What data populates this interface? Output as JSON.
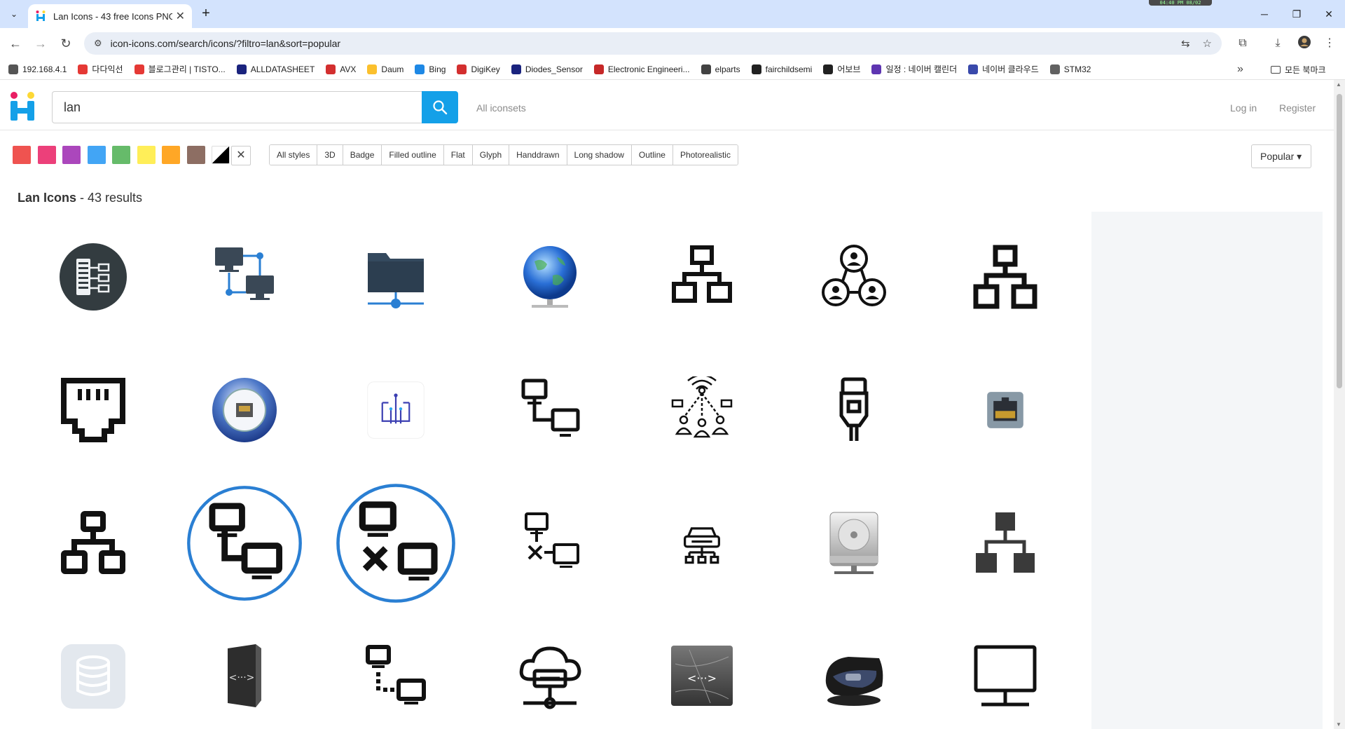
{
  "browser": {
    "tab_title": "Lan Icons - 43 free Icons PNG",
    "clock": "04:40 PM 08/02",
    "url_host": "icon-icons.com",
    "url_path": "/search/icons/?filtro=lan&sort=popular",
    "bookmarks": [
      {
        "label": "192.168.4.1",
        "color": "#555555"
      },
      {
        "label": "다다익선",
        "color": "#e53935"
      },
      {
        "label": "블로그관리 | TISTO...",
        "color": "#e53935"
      },
      {
        "label": "ALLDATASHEET",
        "color": "#1a237e"
      },
      {
        "label": "AVX",
        "color": "#d32f2f"
      },
      {
        "label": "Daum",
        "color": "#fbc02d"
      },
      {
        "label": "Bing",
        "color": "#1e88e5"
      },
      {
        "label": "DigiKey",
        "color": "#d32f2f"
      },
      {
        "label": "Diodes_Sensor",
        "color": "#1a237e"
      },
      {
        "label": "Electronic Engineeri...",
        "color": "#c62828"
      },
      {
        "label": "elparts",
        "color": "#424242"
      },
      {
        "label": "fairchildsemi",
        "color": "#212121"
      },
      {
        "label": "어보브",
        "color": "#212121"
      },
      {
        "label": "일정 : 네이버 캘린더",
        "color": "#5e35b1"
      },
      {
        "label": "네이버 클라우드",
        "color": "#3949ab"
      },
      {
        "label": "STM32",
        "color": "#616161"
      }
    ],
    "all_bookmarks": "모든 북마크"
  },
  "header": {
    "search_value": "lan",
    "all_iconsets": "All iconsets",
    "login": "Log in",
    "register": "Register"
  },
  "filters": {
    "colors": [
      "#ef5350",
      "#ec407a",
      "#ab47bc",
      "#42a5f5",
      "#66bb6a",
      "#ffee58",
      "#ffa726",
      "#8d6e63",
      "#000000"
    ],
    "styles": [
      "All styles",
      "3D",
      "Badge",
      "Filled outline",
      "Flat",
      "Glyph",
      "Handdrawn",
      "Long shadow",
      "Outline",
      "Photorealistic"
    ],
    "sort": "Popular"
  },
  "results": {
    "title": "Lan Icons",
    "sep": " - ",
    "count": "43 results"
  },
  "icons": [
    "server-badge-icon",
    "network-computers-blue-icon",
    "network-folder-icon",
    "globe-network-icon",
    "lan-outline-icon",
    "users-network-icon",
    "network-hierarchy-icon",
    "ethernet-port-icon",
    "ethernet-port-globe-icon",
    "network-interface-icon",
    "computers-link-icon",
    "wireless-people-network-icon",
    "ethernet-cable-icon",
    "ethernet-jack-icon",
    "lan-glyph-icon",
    "computers-link-circle-icon",
    "computers-disconnected-circle-icon",
    "computers-disconnected-icon",
    "network-car-icon",
    "network-drive-icon",
    "lan-hierarchy-flat-icon",
    "database-icon",
    "network-server-box-icon",
    "computers-dotted-link-icon",
    "cloud-network-icon",
    "network-card-icon",
    "router-device-icon",
    "monitor-icon"
  ]
}
